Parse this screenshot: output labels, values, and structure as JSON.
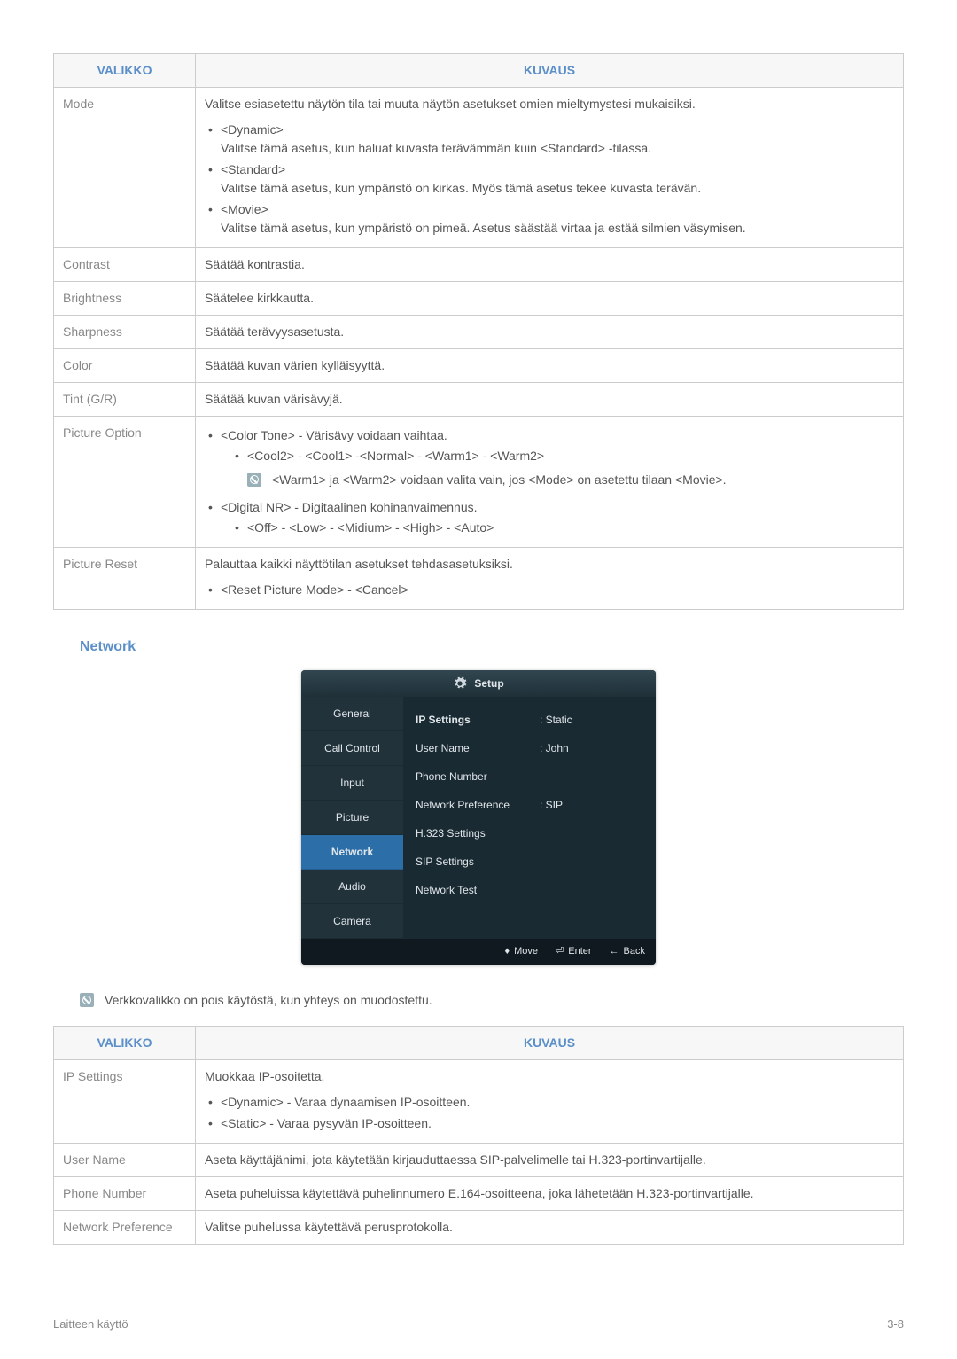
{
  "table1": {
    "headers": {
      "menu": "VALIKKO",
      "desc": "KUVAUS"
    },
    "rows": {
      "mode": {
        "label": "Mode",
        "intro": "Valitse esiasetettu näytön tila tai muuta näytön asetukset omien mieltymystesi mukaisiksi.",
        "item1_title": "<Dynamic>",
        "item1_desc": "Valitse tämä asetus, kun haluat kuvasta terävämmän kuin <Standard> -tilassa.",
        "item2_title": "<Standard>",
        "item2_desc": "Valitse tämä asetus, kun ympäristö on kirkas. Myös tämä asetus tekee kuvasta terävän.",
        "item3_title": "<Movie>",
        "item3_desc": "Valitse tämä asetus, kun ympäristö on pimeä. Asetus säästää virtaa ja estää silmien väsymisen."
      },
      "contrast": {
        "label": "Contrast",
        "desc": "Säätää kontrastia."
      },
      "brightness": {
        "label": "Brightness",
        "desc": "Säätelee kirkkautta."
      },
      "sharpness": {
        "label": "Sharpness",
        "desc": "Säätää terävyysasetusta."
      },
      "color": {
        "label": "Color",
        "desc": "Säätää kuvan värien kylläisyyttä."
      },
      "tint": {
        "label": "Tint (G/R)",
        "desc": "Säätää kuvan värisävyjä."
      },
      "picture_option": {
        "label": "Picture Option",
        "ct_title": "<Color Tone> - Värisävy voidaan vaihtaa.",
        "ct_values": "<Cool2> - <Cool1> -<Normal> - <Warm1> - <Warm2>",
        "ct_note": "<Warm1> ja <Warm2> voidaan valita vain, jos <Mode> on asetettu tilaan <Movie>.",
        "dnr_title": "<Digital NR> - Digitaalinen kohinanvaimennus.",
        "dnr_values": "<Off> - <Low> - <Midium> - <High> - <Auto>"
      },
      "picture_reset": {
        "label": "Picture Reset",
        "desc": "Palauttaa kaikki näyttötilan asetukset tehdasasetuksiksi.",
        "values": "<Reset Picture Mode> - <Cancel>"
      }
    }
  },
  "section_network": "Network",
  "setup": {
    "title": "Setup",
    "side": {
      "general": "General",
      "call_control": "Call Control",
      "input": "Input",
      "picture": "Picture",
      "network": "Network",
      "audio": "Audio",
      "camera": "Camera"
    },
    "rows": {
      "ip_settings": {
        "label": "IP Settings",
        "value": ": Static"
      },
      "user_name": {
        "label": "User Name",
        "value": ": John"
      },
      "phone_number": {
        "label": "Phone Number",
        "value": ""
      },
      "network_pref": {
        "label": "Network Preference",
        "value": ": SIP"
      },
      "h323": {
        "label": "H.323 Settings",
        "value": ""
      },
      "sip": {
        "label": "SIP Settings",
        "value": ""
      },
      "test": {
        "label": "Network Test",
        "value": ""
      }
    },
    "footer": {
      "move": "Move",
      "enter": "Enter",
      "back": "Back"
    }
  },
  "network_note": "Verkkovalikko on pois käytöstä, kun yhteys on muodostettu.",
  "table2": {
    "headers": {
      "menu": "VALIKKO",
      "desc": "KUVAUS"
    },
    "rows": {
      "ip": {
        "label": "IP Settings",
        "intro": "Muokkaa IP-osoitetta.",
        "b1": "<Dynamic> - Varaa dynaamisen IP-osoitteen.",
        "b2": "<Static> - Varaa pysyvän IP-osoitteen."
      },
      "user": {
        "label": "User Name",
        "desc": "Aseta käyttäjänimi, jota käytetään kirjauduttaessa SIP-palvelimelle tai H.323-portinvartijalle."
      },
      "phone": {
        "label": "Phone Number",
        "desc": "Aseta puheluissa käytettävä puhelinnumero E.164-osoitteena, joka lähetetään H.323-portinvartijalle."
      },
      "pref": {
        "label": "Network Preference",
        "desc": "Valitse puhelussa käytettävä perusprotokolla."
      }
    }
  },
  "footer": {
    "left": "Laitteen käyttö",
    "right": "3-8"
  }
}
